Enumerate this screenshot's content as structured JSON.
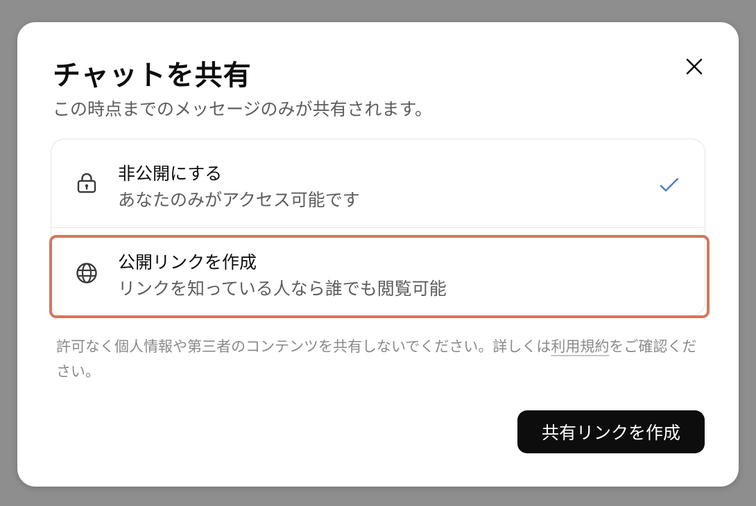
{
  "dialog": {
    "title": "チャットを共有",
    "subtitle": "この時点までのメッセージのみが共有されます。",
    "close_icon": "close-icon"
  },
  "options": [
    {
      "icon": "lock-icon",
      "title": "非公開にする",
      "description": "あなたのみがアクセス可能です",
      "selected": true
    },
    {
      "icon": "globe-icon",
      "title": "公開リンクを作成",
      "description": "リンクを知っている人なら誰でも閲覧可能",
      "selected": false
    }
  ],
  "colors": {
    "check": "#4a7fc1",
    "highlight": "#d3775f",
    "primary_button_bg": "#0d0d0d"
  },
  "disclaimer": {
    "text_before": "許可なく個人情報や第三者のコンテンツを共有しないでください。詳しくは",
    "terms_link": "利用規約",
    "text_after": "をご確認ください。"
  },
  "actions": {
    "create_label": "共有リンクを作成"
  }
}
